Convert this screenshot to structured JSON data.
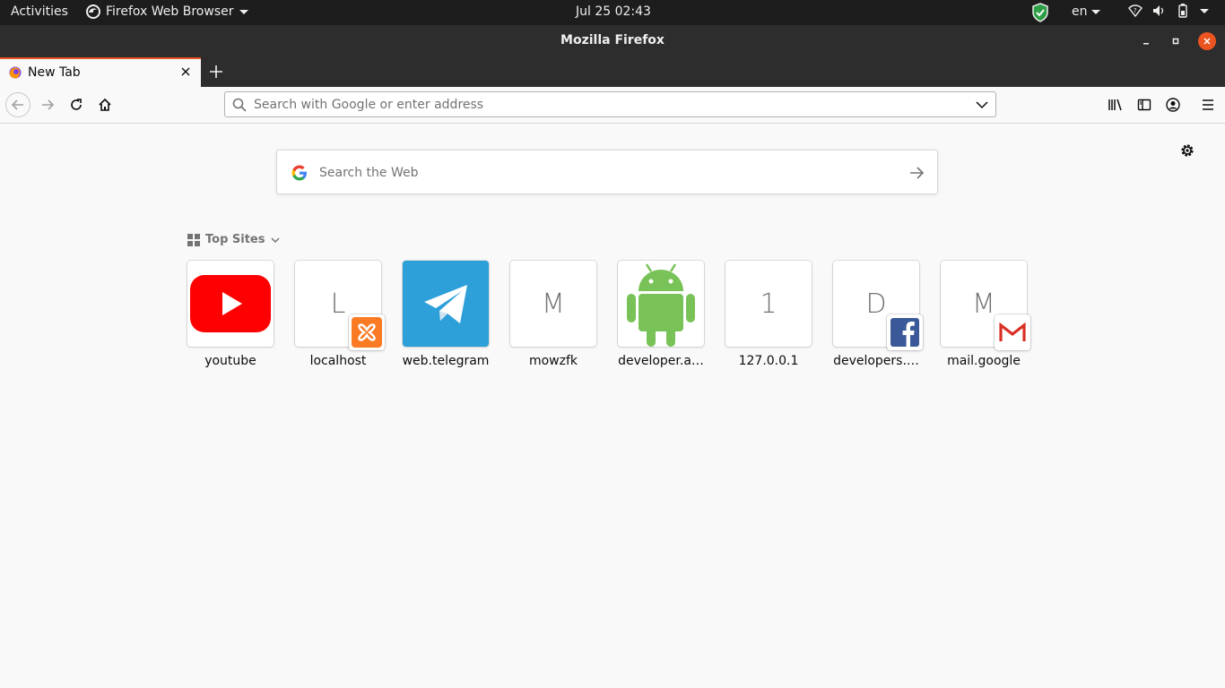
{
  "topbar": {
    "activities": "Activities",
    "app_menu": "Firefox Web Browser",
    "clock": "Jul 25  02:43",
    "language": "en"
  },
  "window": {
    "title": "Mozilla Firefox"
  },
  "tabs": [
    {
      "label": "New Tab",
      "active": true
    }
  ],
  "urlbar": {
    "placeholder": "Search with Google or enter address",
    "value": ""
  },
  "newtab": {
    "search_placeholder": "Search the Web",
    "top_sites_label": "Top Sites",
    "sites": [
      {
        "label": "youtube",
        "icon": "youtube-icon"
      },
      {
        "label": "localhost",
        "letter": "L",
        "badge": "xampp-icon"
      },
      {
        "label": "web.telegram",
        "icon": "telegram-icon"
      },
      {
        "label": "mowzfk",
        "letter": "M"
      },
      {
        "label": "developer.a…",
        "icon": "android-icon"
      },
      {
        "label": "127.0.0.1",
        "letter": "1"
      },
      {
        "label": "developers.…",
        "letter": "D",
        "badge": "facebook-icon"
      },
      {
        "label": "mail.google",
        "letter": "M",
        "badge": "gmail-icon"
      }
    ]
  },
  "colors": {
    "accent": "#e95420",
    "topbar_bg": "#1d1d1d",
    "titlebar_bg": "#2d2d2d",
    "page_bg": "#f9f9fa"
  }
}
